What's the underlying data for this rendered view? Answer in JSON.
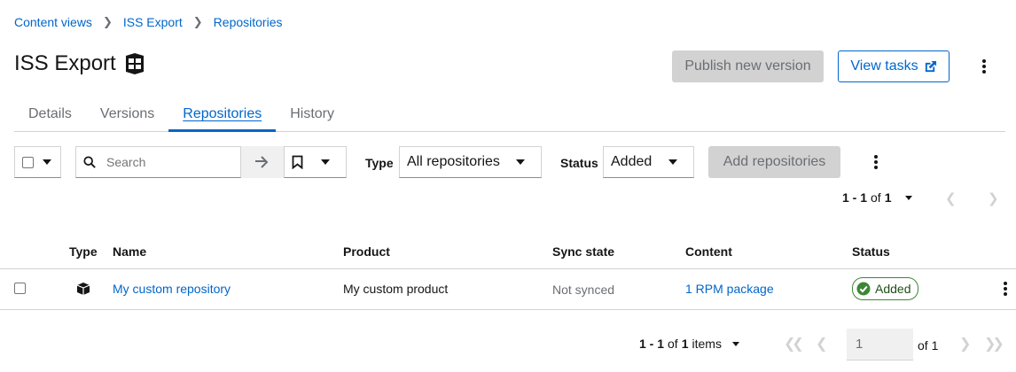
{
  "breadcrumb": [
    "Content views",
    "ISS Export",
    "Repositories"
  ],
  "title": "ISS Export",
  "header": {
    "publish_label": "Publish new version",
    "view_tasks_label": "View tasks"
  },
  "tabs": [
    {
      "label": "Details",
      "active": false
    },
    {
      "label": "Versions",
      "active": false
    },
    {
      "label": "Repositories",
      "active": true
    },
    {
      "label": "History",
      "active": false
    }
  ],
  "toolbar": {
    "search_placeholder": "Search",
    "type_label": "Type",
    "type_value": "All repositories",
    "status_label": "Status",
    "status_value": "Added",
    "add_label": "Add repositories"
  },
  "pagination_top": {
    "range": "1 - 1",
    "of_label": "of",
    "total": "1"
  },
  "table": {
    "columns": [
      "Type",
      "Name",
      "Product",
      "Sync state",
      "Content",
      "Status"
    ],
    "rows": [
      {
        "type_icon": "repository-icon",
        "name": "My custom repository",
        "product": "My custom product",
        "sync_state": "Not synced",
        "content": "1 RPM package",
        "status": "Added"
      }
    ]
  },
  "pagination_bottom": {
    "range": "1 - 1",
    "of_label": "of",
    "total": "1",
    "items_label": "items",
    "page": "1",
    "page_of": "of 1"
  },
  "colors": {
    "link": "#0066cc",
    "success": "#3e8635",
    "disabled_bg": "#d2d2d2"
  }
}
